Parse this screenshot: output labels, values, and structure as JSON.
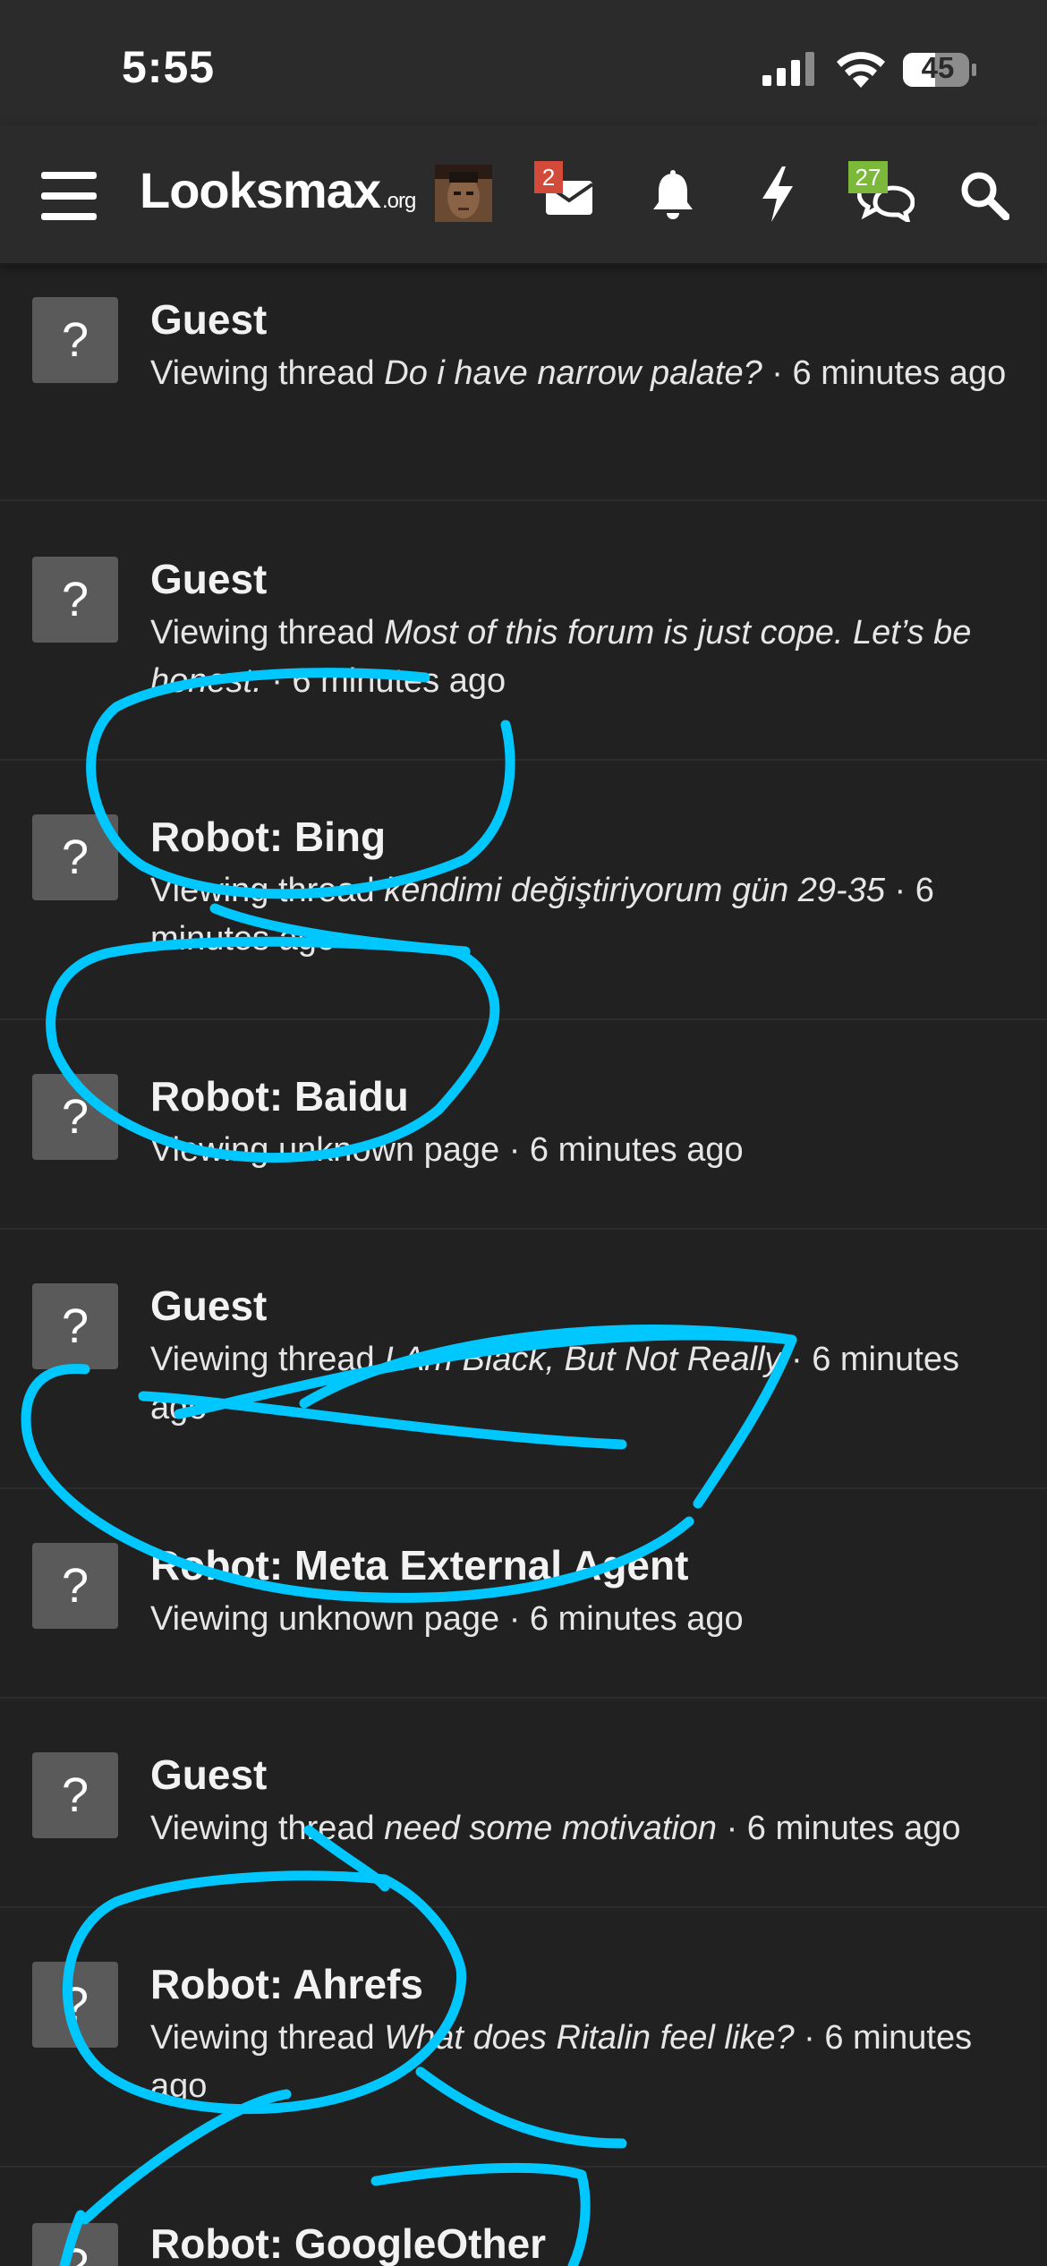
{
  "status_bar": {
    "time": "5:55",
    "battery": "45",
    "icons": [
      "cellular-signal-icon",
      "wifi-icon",
      "battery-icon"
    ]
  },
  "navbar": {
    "logo_main": "Looksmax",
    "logo_tld": ".org",
    "icons": [
      "menu-icon",
      "avatar",
      "mail-icon",
      "bell-icon",
      "bolt-icon",
      "chat-icon",
      "search-icon"
    ],
    "mail_badge": "2",
    "chat_badge": "27"
  },
  "colors": {
    "background": "#212121",
    "bar": "#2b2b2b",
    "mail_badge": "#d24b3a",
    "chat_badge": "#7cb83a",
    "annotation": "#00c8ff"
  },
  "avatar_icon": "?",
  "rows": [
    {
      "name": "Guest",
      "prefix": "Viewing thread ",
      "title": "Do i have narrow palate?",
      "suffix": " · 6 minutes ago"
    },
    {
      "name": "Guest",
      "prefix": "Viewing thread ",
      "title": "Most of this forum is just cope. Let’s be honest.",
      "suffix": " · 6 minutes ago"
    },
    {
      "name": "Robot: Bing",
      "prefix": "Viewing thread ",
      "title": "kendimi değiştiriyorum gün 29-35",
      "suffix": " · 6 minutes ago"
    },
    {
      "name": "Robot: Baidu",
      "prefix": "Viewing unknown page",
      "title": "",
      "suffix": " · 6 minutes ago"
    },
    {
      "name": "Guest",
      "prefix": "Viewing thread ",
      "title": "I Am Black, But Not Really",
      "suffix": " · 6 minutes ago"
    },
    {
      "name": "Robot: Meta External Agent",
      "prefix": "Viewing unknown page",
      "title": "",
      "suffix": " · 6 minutes ago"
    },
    {
      "name": "Guest",
      "prefix": "Viewing thread ",
      "title": "need some motivation",
      "suffix": " · 6 minutes ago"
    },
    {
      "name": "Robot: Ahrefs",
      "prefix": "Viewing thread ",
      "title": "What does Ritalin feel like?",
      "suffix": " · 6 minutes ago"
    },
    {
      "name": "Robot: GoogleOther",
      "prefix": "",
      "title": "",
      "suffix": ""
    }
  ]
}
